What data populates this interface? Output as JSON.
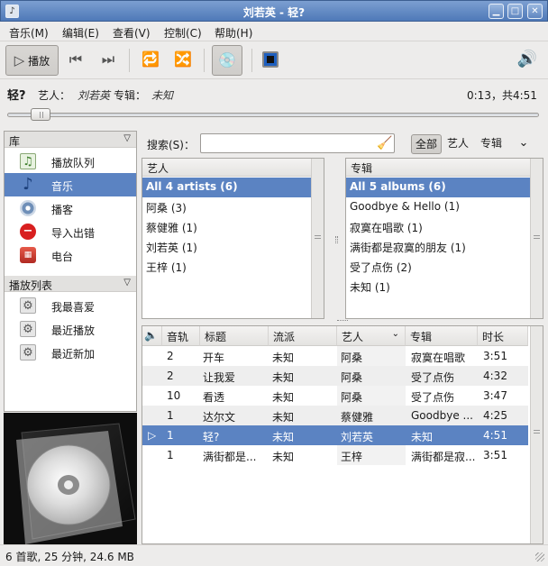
{
  "window": {
    "title": "刘若英 - 轻?",
    "icon_label": "",
    "buttons": {
      "minimize": "▁",
      "maximize": "□",
      "close": "✕"
    }
  },
  "menu": [
    "音乐(M)",
    "编辑(E)",
    "查看(V)",
    "控制(C)",
    "帮助(H)"
  ],
  "toolbar": {
    "play_label": "播放"
  },
  "now_playing": {
    "title": "轻?",
    "artist_label": "艺人：",
    "artist": "刘若英",
    "album_label": "专辑：",
    "album": "未知",
    "time": "0:13，共4:51",
    "progress": 0.045
  },
  "sidebar": {
    "library_header": "库",
    "library_items": [
      {
        "label": "播放队列",
        "icon": "music-note-icon"
      },
      {
        "label": "音乐",
        "icon": "music-note-icon",
        "selected": true
      },
      {
        "label": "播客",
        "icon": "podcast-icon"
      },
      {
        "label": "导入出错",
        "icon": "error-icon"
      },
      {
        "label": "电台",
        "icon": "radio-icon"
      }
    ],
    "playlists_header": "播放列表",
    "playlist_items": [
      {
        "label": "我最喜爱",
        "icon": "gear-icon"
      },
      {
        "label": "最近播放",
        "icon": "gear-icon"
      },
      {
        "label": "最近新加",
        "icon": "gear-icon"
      }
    ]
  },
  "search": {
    "label": "搜索(S)：",
    "value": "",
    "placeholder": ""
  },
  "filters": {
    "all": "全部",
    "artist": "艺人",
    "album": "专辑"
  },
  "artist_browser": {
    "header": "艺人",
    "rows": [
      "All 4 artists (6)",
      "阿桑 (3)",
      "蔡健雅 (1)",
      "刘若英 (1)",
      "王梓 (1)"
    ]
  },
  "album_browser": {
    "header": "专辑",
    "rows": [
      "All 5 albums (6)",
      "Goodbye & Hello (1)",
      "寂寞在唱歌 (1)",
      "满街都是寂寞的朋友 (1)",
      "受了点伤 (2)",
      "未知 (1)"
    ]
  },
  "tracks": {
    "columns": [
      "音轨",
      "标题",
      "流派",
      "艺人",
      "专辑",
      "时长"
    ],
    "rows": [
      {
        "track": "2",
        "title": "开车",
        "genre": "未知",
        "artist": "阿桑",
        "album": "寂寞在唱歌",
        "duration": "3:51"
      },
      {
        "track": "2",
        "title": "让我爱",
        "genre": "未知",
        "artist": "阿桑",
        "album": "受了点伤",
        "duration": "4:32"
      },
      {
        "track": "10",
        "title": "看透",
        "genre": "未知",
        "artist": "阿桑",
        "album": "受了点伤",
        "duration": "3:47"
      },
      {
        "track": "1",
        "title": "达尔文",
        "genre": "未知",
        "artist": "蔡健雅",
        "album": "Goodbye ...",
        "duration": "4:25"
      },
      {
        "track": "1",
        "title": "轻?",
        "genre": "未知",
        "artist": "刘若英",
        "album": "未知",
        "duration": "4:51",
        "playing": true
      },
      {
        "track": "1",
        "title": "满街都是...",
        "genre": "未知",
        "artist": "王梓",
        "album": "满街都是寂...",
        "duration": "3:51"
      }
    ]
  },
  "status": "6 首歌, 25 分钟, 24.6 MB",
  "colors": {
    "selection": "#5b83c2",
    "titlebar": "#4f79b8"
  }
}
